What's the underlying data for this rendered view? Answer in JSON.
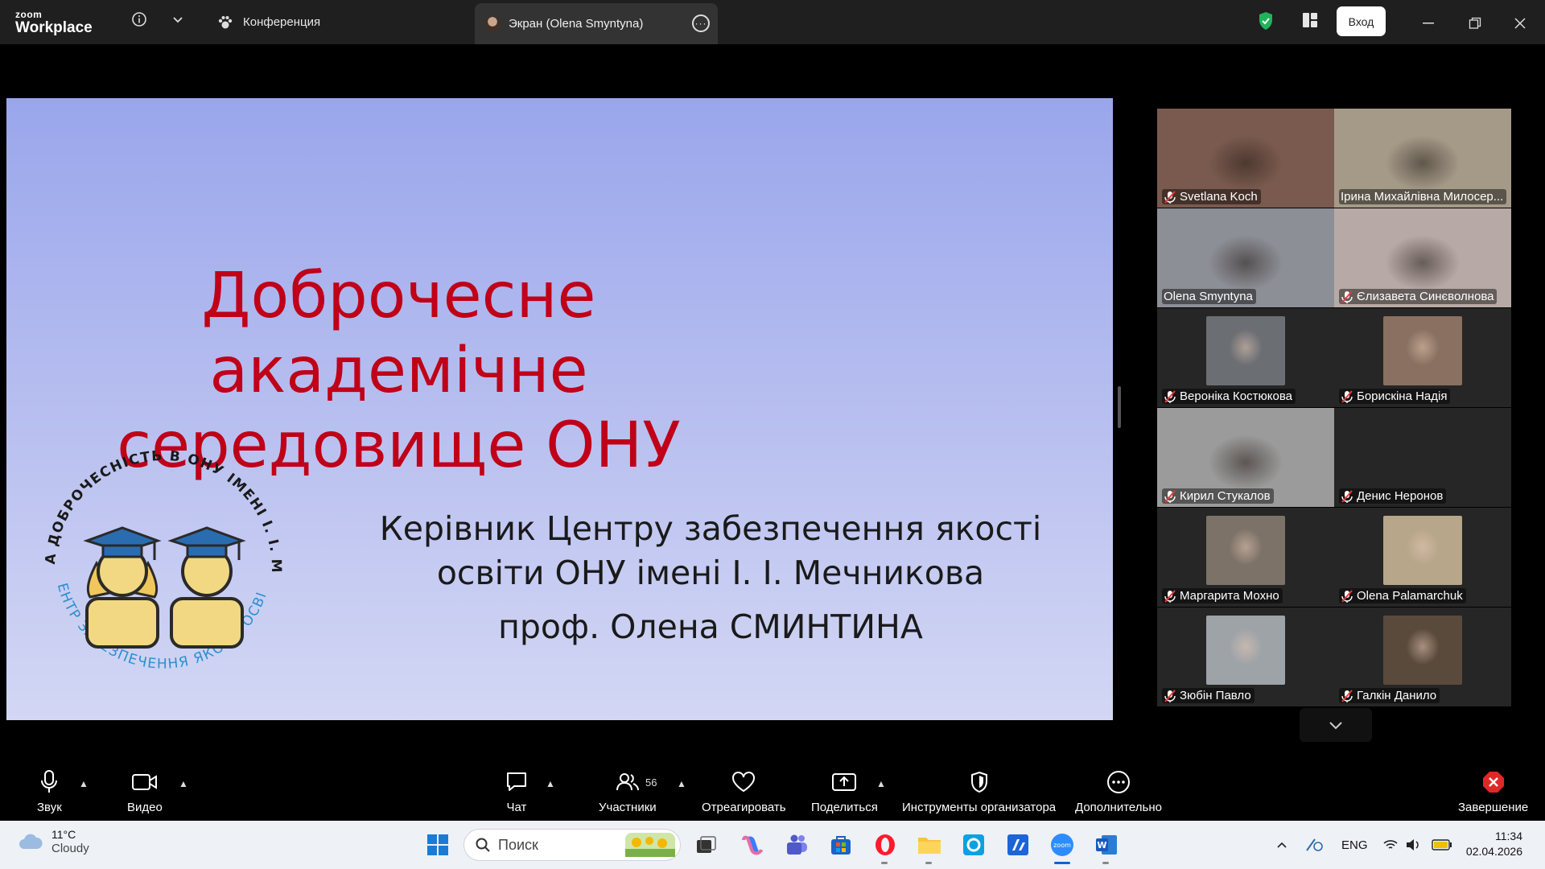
{
  "app": {
    "logo_top": "zoom",
    "logo_bottom": "Workplace",
    "tabs": {
      "conference_label": "Конференция",
      "screen_label": "Экран (Olena Smyntyna)"
    },
    "login_label": "Вход"
  },
  "slide": {
    "title": "Доброчесне академічне\nсередовище ОНУ",
    "subtitle_line1": "Керівник Центру забезпечення якості",
    "subtitle_line2": "освіти  ОНУ імені І. І. Мечникова",
    "subtitle_line3": "проф. Олена СМИНТИНА",
    "emblem_top_text": "АКАДЕМІЧНА ДОБРОЧЕСНІСТЬ В ОНУ ІМЕНІ І. І. МЕЧНИКОВА",
    "emblem_bottom_text": "ЦЕНТР ЗАБЕЗПЕЧЕННЯ ЯКОСТІ ОСВІТИ",
    "title_color": "#c00018"
  },
  "participants": [
    {
      "name": "Svetlana Koch",
      "muted": true,
      "style": "full",
      "bg": "#7a5a4e"
    },
    {
      "name": "Ірина Михайлівна Милосер...",
      "muted": false,
      "style": "full",
      "bg": "#a59a88"
    },
    {
      "name": "Olena Smyntyna",
      "muted": false,
      "style": "full",
      "bg": "#8d8f96",
      "active": true
    },
    {
      "name": "Єлизавета Синєволнова",
      "muted": true,
      "style": "full",
      "bg": "#b7a9a5"
    },
    {
      "name": "Вероніка Костюкова",
      "muted": true,
      "style": "small",
      "bg": "#6b6e73"
    },
    {
      "name": "Борискіна Надія",
      "muted": true,
      "style": "small",
      "bg": "#8a7060"
    },
    {
      "name": "Кирил Стукалов",
      "muted": true,
      "style": "full",
      "bg": "#9b9b9b"
    },
    {
      "name": "Денис Неронов",
      "muted": true,
      "style": "empty",
      "bg": "#262626"
    },
    {
      "name": "Маргарита Мохно",
      "muted": true,
      "style": "small",
      "bg": "#7d7268"
    },
    {
      "name": "Olena Palamarchuk",
      "muted": true,
      "style": "small",
      "bg": "#b7a68a"
    },
    {
      "name": "Зюбін Павло",
      "muted": true,
      "style": "small",
      "bg": "#9ea3a8"
    },
    {
      "name": "Галкін Данило",
      "muted": true,
      "style": "small",
      "bg": "#5a4a3c"
    }
  ],
  "toolbar": {
    "audio": "Звук",
    "video": "Видео",
    "chat": "Чат",
    "participants": "Участники",
    "participants_count": "56",
    "react": "Отреагировать",
    "share": "Поделиться",
    "host_tools": "Инструменты организатора",
    "more": "Дополнительно",
    "end": "Завершение",
    "end_color": "#e02828"
  },
  "taskbar": {
    "temp": "11°C",
    "condition": "Cloudy",
    "search_placeholder": "Поиск",
    "language": "ENG",
    "time": "11:34",
    "date": "02.04.2026"
  }
}
